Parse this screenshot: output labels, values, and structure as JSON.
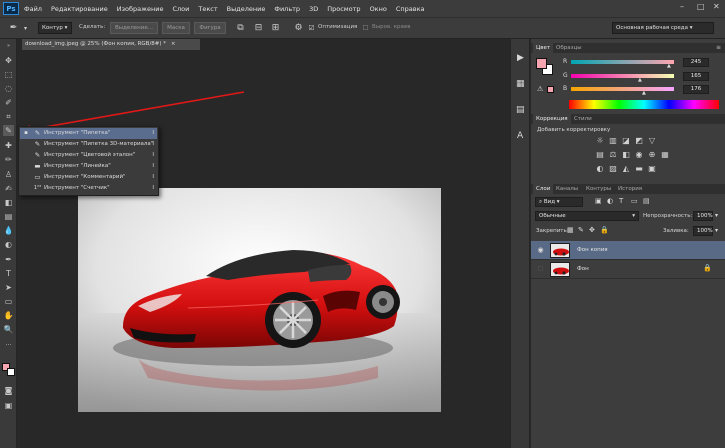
{
  "app": {
    "logo": "Ps"
  },
  "menu": [
    "Файл",
    "Редактирование",
    "Изображение",
    "Слои",
    "Текст",
    "Выделение",
    "Фильтр",
    "3D",
    "Просмотр",
    "Окно",
    "Справка"
  ],
  "window_controls": {
    "minimize": "–",
    "maximize": "□",
    "close": "✕"
  },
  "options": {
    "mode_select": "Контур",
    "make_label": "Сделать:",
    "selection_btn": "Выделение...",
    "mask_btn": "Маска",
    "shape_btn": "Фигура",
    "optimize_label": "Оптимизация",
    "align_label": "Выров. краев",
    "workspace": "Основная рабочая среда"
  },
  "document": {
    "tab_title": "download_img.jpeg @ 25% (Фон копия, RGB/8#) *",
    "close": "×"
  },
  "flyout": [
    {
      "label": "Инструмент \"Пипетка\"",
      "key": "I",
      "icon": "eyedropper-icon",
      "glyph": "✎",
      "selected": true
    },
    {
      "label": "Инструмент \"Пипетка 3D-материала\"",
      "key": "I",
      "icon": "3d-eyedropper-icon",
      "glyph": "✎",
      "selected": false
    },
    {
      "label": "Инструмент \"Цветовой эталон\"",
      "key": "I",
      "icon": "color-sampler-icon",
      "glyph": "✎",
      "selected": false
    },
    {
      "label": "Инструмент \"Линейка\"",
      "key": "I",
      "icon": "ruler-icon",
      "glyph": "▬",
      "selected": false
    },
    {
      "label": "Инструмент \"Комментарий\"",
      "key": "I",
      "icon": "note-icon",
      "glyph": "▭",
      "selected": false
    },
    {
      "label": "Инструмент \"Счетчик\"",
      "key": "I",
      "icon": "counter-icon",
      "glyph": "1²³",
      "selected": false
    }
  ],
  "color_panel": {
    "tabs": [
      "Цвет",
      "Образцы"
    ],
    "r_label": "R",
    "g_label": "G",
    "b_label": "B",
    "r": "245",
    "g": "165",
    "b": "176",
    "foreground": "#f5a5b0",
    "background": "#ffffff"
  },
  "adjust_panel": {
    "tabs": [
      "Коррекция",
      "Стили"
    ],
    "title": "Добавить корректировку"
  },
  "layers_panel": {
    "tabs": [
      "Слои",
      "Каналы",
      "Контуры",
      "История"
    ],
    "filter": "Вид",
    "blend_mode": "Обычные",
    "opacity_label": "Непрозрачность:",
    "opacity": "100%",
    "lock_label": "Закрепить:",
    "fill_label": "Заливка:",
    "fill": "100%",
    "layers": [
      {
        "name": "Фон копия",
        "selected": true,
        "visible": true,
        "locked": false
      },
      {
        "name": "Фон",
        "selected": false,
        "visible": false,
        "locked": true
      }
    ]
  }
}
